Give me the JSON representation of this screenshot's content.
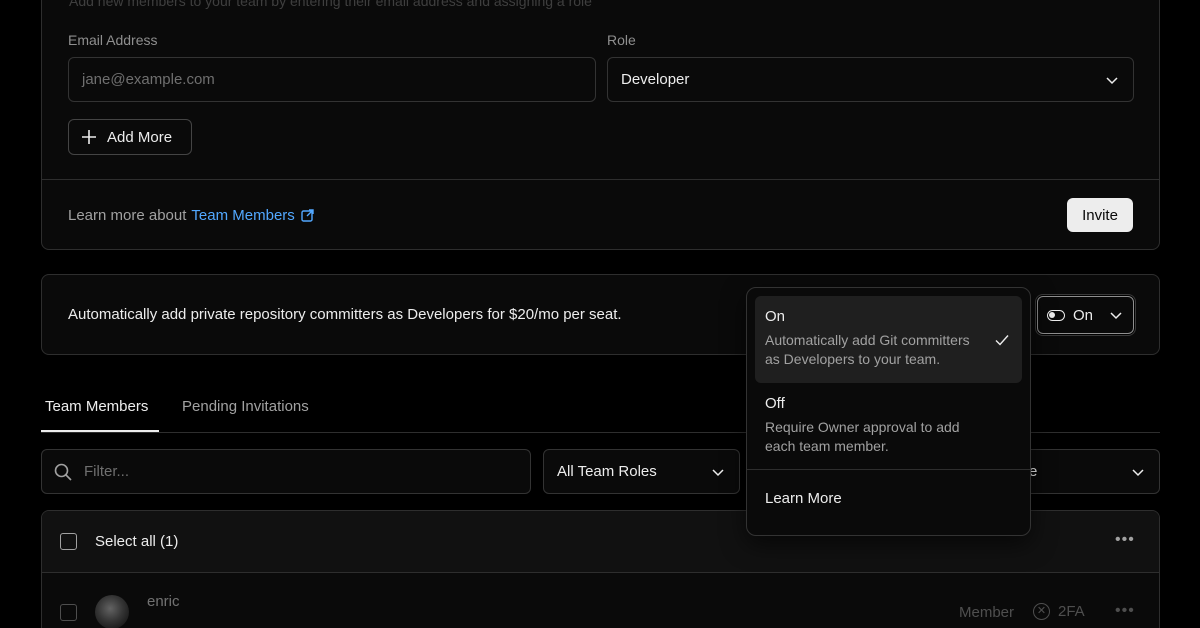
{
  "invite": {
    "description": "Add new members to your team by entering their email address and assigning a role",
    "email_label": "Email Address",
    "email_placeholder": "jane@example.com",
    "role_label": "Role",
    "role_value": "Developer",
    "add_more_label": "Add More",
    "learn_prefix": "Learn more about",
    "learn_link": "Team Members",
    "invite_button": "Invite"
  },
  "auto_add": {
    "text": "Automatically add private repository committers as Developers for $20/mo per seat.",
    "toggle_value": "On"
  },
  "dropdown": {
    "options": [
      {
        "title": "On",
        "description": "Automatically add Git committers as Developers to your team.",
        "selected": true
      },
      {
        "title": "Off",
        "description": "Require Owner approval to add each team member.",
        "selected": false
      }
    ],
    "learn_more": "Learn More"
  },
  "tabs": {
    "members": "Team Members",
    "pending": "Pending Invitations"
  },
  "filters": {
    "filter_placeholder": "Filter...",
    "roles_value": "All Team Roles",
    "third_partial": "e"
  },
  "members": {
    "select_all": "Select all (1)",
    "rows": [
      {
        "name": "enric",
        "role": "Member",
        "twofa": "2FA"
      }
    ]
  },
  "colors": {
    "accent_link": "#52a8ff",
    "background": "#000000",
    "card": "#0a0a0a",
    "border": "#2e2e2e"
  },
  "icons": [
    "plus-icon",
    "external-link-icon",
    "chevron-down-icon",
    "toggle-icon",
    "check-icon",
    "search-icon",
    "more-icon",
    "x-circle-icon"
  ]
}
